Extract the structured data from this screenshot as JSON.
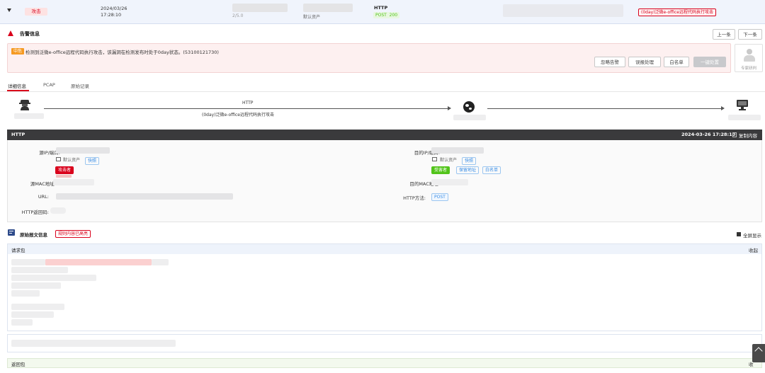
{
  "top_row": {
    "type_tag": "攻击",
    "date": "2024/03/26",
    "time": "17:28:10",
    "asset_fragment": "2/5.0",
    "asset_name": "默认资产",
    "protocol": "HTTP",
    "method": "POST",
    "status_code": "200",
    "threat_name": "(0day)泛微e-office远程代码执行攻击"
  },
  "alert": {
    "section_title": "告警信息",
    "prev_button": "上一条",
    "next_button": "下一条",
    "severity": "中危",
    "description": "检测到泛微e-office远程代码执行攻击，该漏洞在检测发布时处于0day状态。(53100121730)",
    "buttons": {
      "ignore": "忽略告警",
      "handled": "误报处理",
      "whitelist": "白名单",
      "onekey": "一键处置"
    },
    "expert_label": "专家研判"
  },
  "tabs": {
    "detail": "详细信息",
    "pcap": "PCAP",
    "raw": "原始记录"
  },
  "flow": {
    "protocol": "HTTP",
    "attack_name": "(0day)泛微e-office远程代码执行攻击"
  },
  "http_panel": {
    "title": "HTTP",
    "datetime": "2024-03-26 17:28:10",
    "copy_label": "复制内容",
    "src_label": "源IP/端口:",
    "src_asset": "默认资产",
    "src_asset_tag": "快照",
    "attacker_tag": "攻击者",
    "dst_label": "目的IP/端口:",
    "dst_asset": "默认资产",
    "dst_asset_tag": "快照",
    "victim_tag": "受害者",
    "private_addr_tag": "保留地址",
    "whitelist_tag": "白名单",
    "src_mac_label": "源MAC地址:",
    "dst_mac_label": "目的MAC地址:",
    "url_label": "URL:",
    "method_label": "HTTP方法:",
    "method_value": "POST",
    "status_label": "HTTP返回码:"
  },
  "raw_packets": {
    "title": "原始报文信息",
    "highlight_tag": "规则内容已高亮",
    "fullscreen": "全屏显示",
    "request_label": "请求包",
    "collapse": "收起",
    "response_label": "返回包",
    "collapse_short": "收"
  },
  "colors": {
    "danger": "#d9001b",
    "success": "#52c41a",
    "link_blue": "#3a8ee6",
    "dark_bar": "#3a3a3c",
    "alert_bg": "#fdf0f0"
  }
}
